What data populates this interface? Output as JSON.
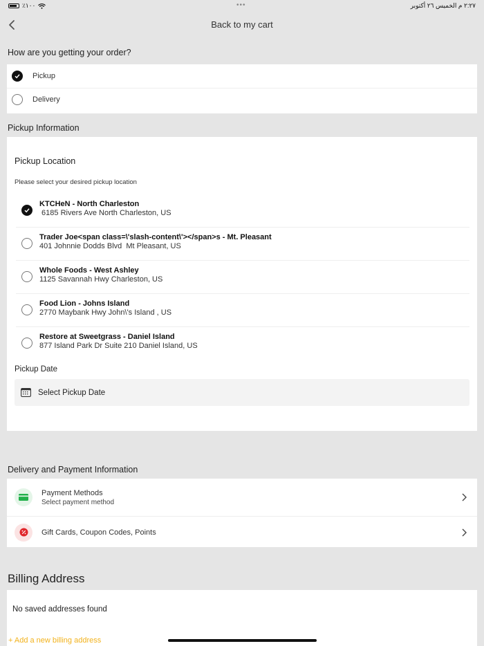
{
  "status": {
    "battery_text": "٪١٠٠",
    "time_date": "٢:٢٧ م  الخميس ٢٦ أكتوبر",
    "dots": "•••"
  },
  "nav": {
    "title": "Back to my cart"
  },
  "order_method": {
    "title": "How are you getting your order?",
    "options": [
      {
        "label": "Pickup",
        "selected": true
      },
      {
        "label": "Delivery",
        "selected": false
      }
    ]
  },
  "pickup": {
    "section_title": "Pickup Information",
    "location_title": "Pickup Location",
    "hint": "Please select your desired pickup location",
    "locations": [
      {
        "name": "KTCHeN - North Charleston",
        "address": " 6185 Rivers Ave North Charleston, US",
        "selected": true
      },
      {
        "name": "Trader Joe<span class=\\'slash-content\\'></span>s - Mt. Pleasant",
        "address": "401 Johnnie Dodds Blvd  Mt Pleasant, US",
        "selected": false
      },
      {
        "name": "Whole Foods - West Ashley",
        "address": "1125 Savannah Hwy Charleston, US",
        "selected": false
      },
      {
        "name": "Food Lion - Johns Island",
        "address": "2770 Maybank Hwy John\\'s Island , US",
        "selected": false
      },
      {
        "name": "Restore at Sweetgrass - Daniel Island",
        "address": "877 Island Park Dr Suite 210 Daniel Island, US",
        "selected": false
      }
    ],
    "date_title": "Pickup Date",
    "date_placeholder": "Select Pickup Date"
  },
  "delivery_payment": {
    "section_title": "Delivery and Payment Information",
    "payment_title": "Payment Methods",
    "payment_sub": "Select payment method",
    "gift_title": "Gift Cards, Coupon Codes, Points",
    "colors": {
      "payment_icon": "#22b04b",
      "gift_icon": "#e0262b"
    }
  },
  "billing": {
    "title": "Billing Address",
    "empty_text": "No saved addresses found",
    "add_link": "+ Add a new billing address"
  }
}
